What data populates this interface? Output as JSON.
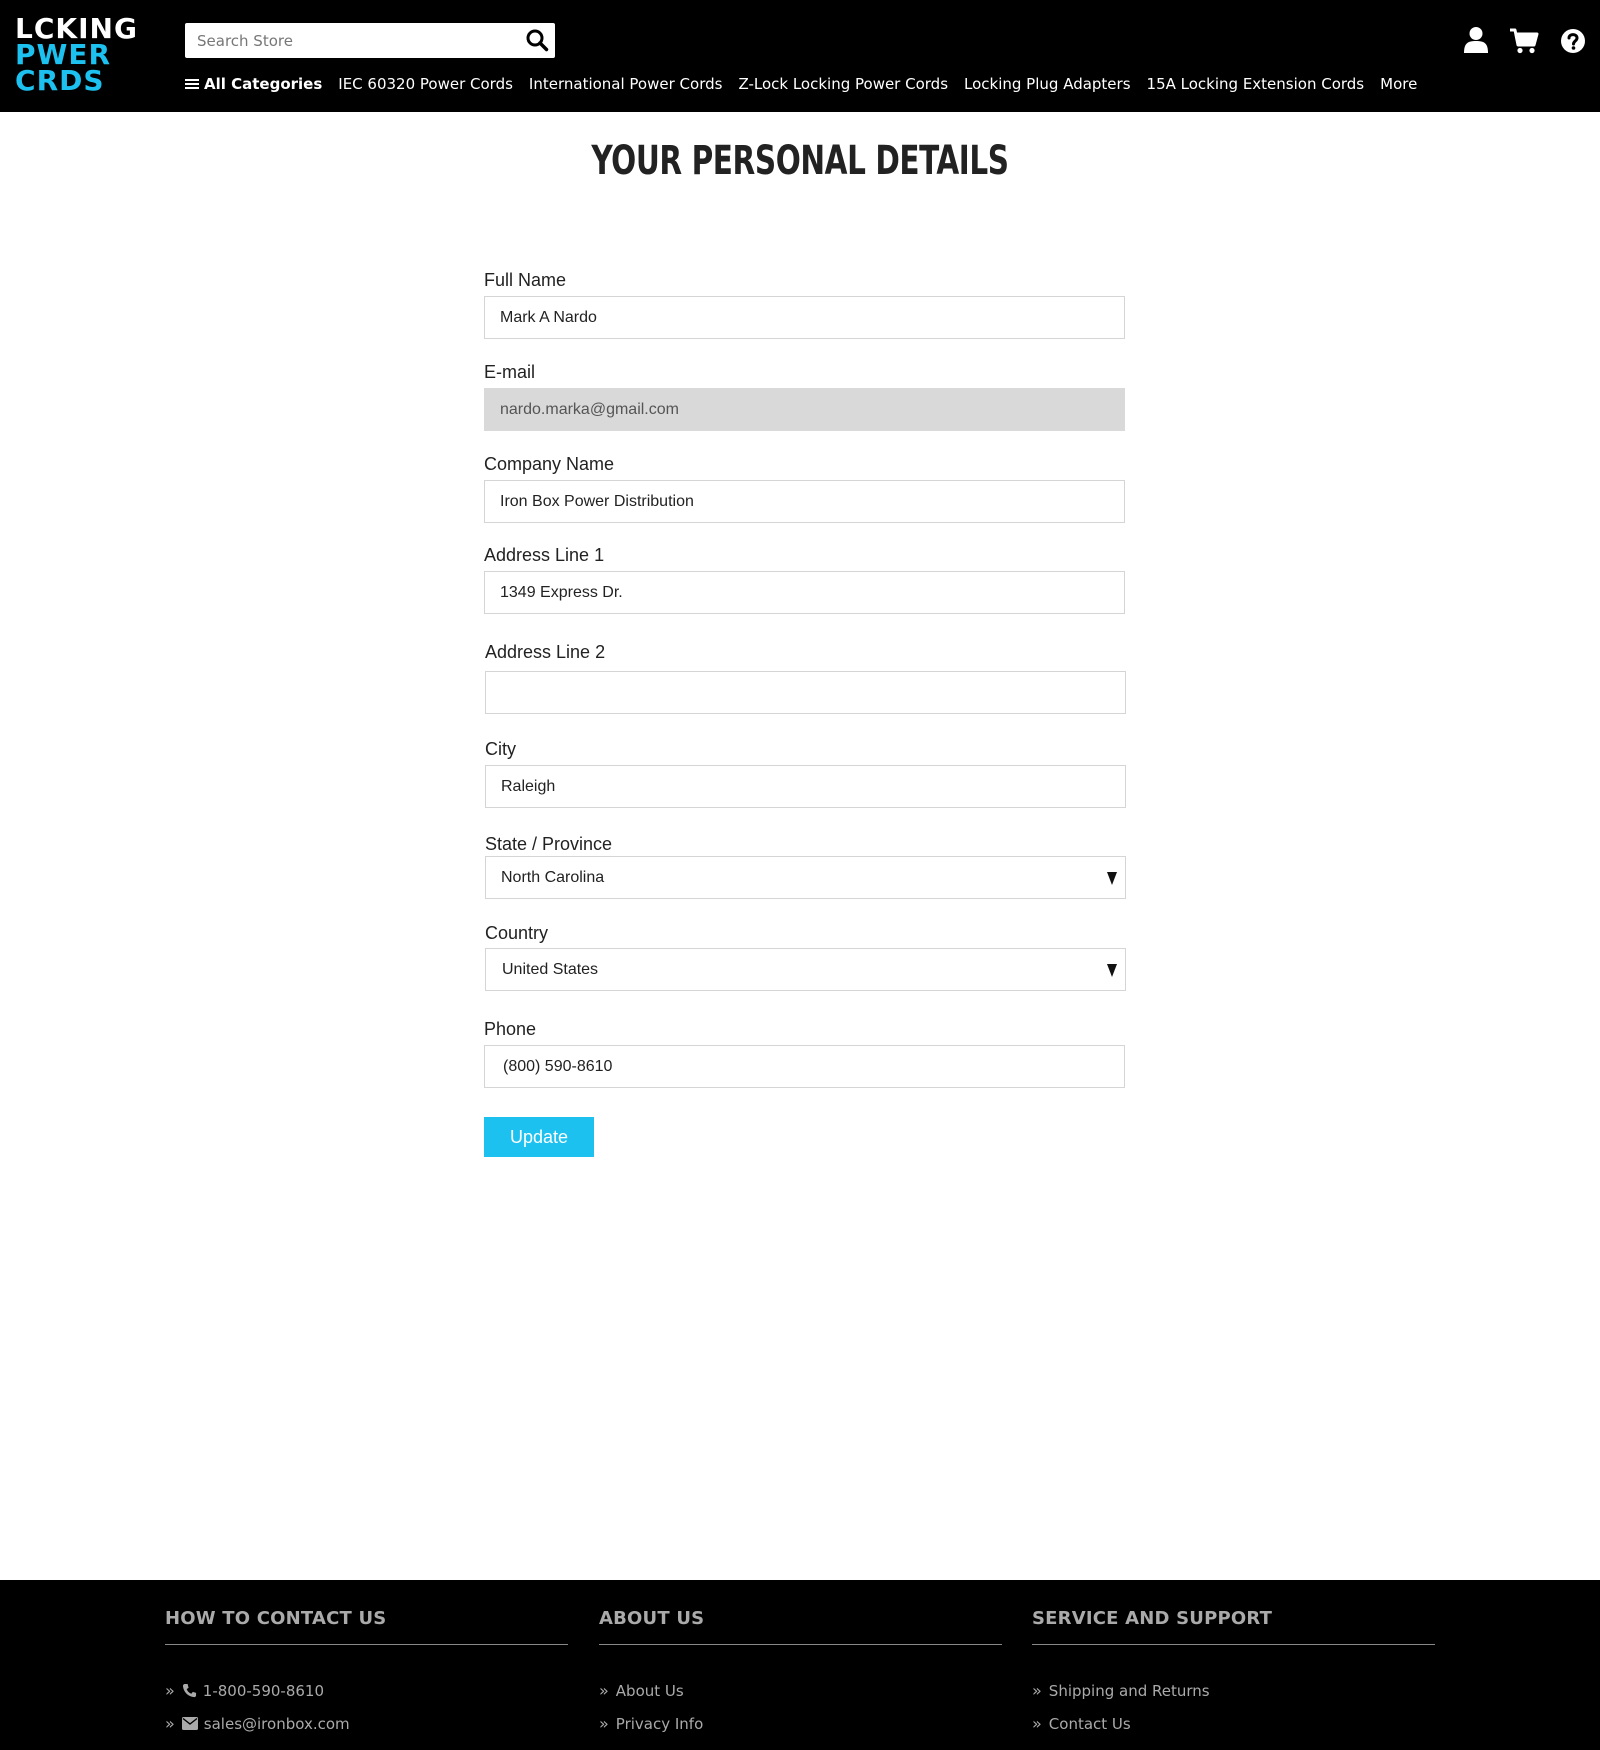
{
  "header": {
    "logo": {
      "line1": [
        "L",
        "CKING"
      ],
      "line2": [
        "P",
        "WER"
      ],
      "line3": [
        "C",
        "RDS"
      ]
    },
    "search_placeholder": "Search Store",
    "nav": [
      "All Categories",
      "IEC 60320 Power Cords",
      "International Power Cords",
      "Z-Lock Locking Power Cords",
      "Locking Plug Adapters",
      "15A Locking Extension Cords",
      "More"
    ],
    "icons": [
      "user-icon",
      "cart-icon",
      "help-icon"
    ],
    "colors": {
      "background": "#000000",
      "accent": "#1dc1f0"
    }
  },
  "page": {
    "title": "YOUR PERSONAL DETAILS"
  },
  "form": {
    "full_name": {
      "label": "Full Name",
      "value": "Mark A Nardo"
    },
    "email": {
      "label": "E-mail",
      "value": "nardo.marka@gmail.com"
    },
    "company": {
      "label": "Company Name",
      "value": "Iron Box Power Distribution"
    },
    "address1": {
      "label": "Address Line 1",
      "value": "1349 Express Dr."
    },
    "address2": {
      "label": "Address Line 2",
      "value": ""
    },
    "city": {
      "label": "City",
      "value": "Raleigh"
    },
    "state": {
      "label": "State / Province",
      "value": "North Carolina"
    },
    "country": {
      "label": "Country",
      "value": "United States"
    },
    "phone": {
      "label": "Phone",
      "value": "(800) 590-8610"
    },
    "submit_label": "Update"
  },
  "footer": {
    "contact": {
      "heading": "HOW TO CONTACT US",
      "phone": "1-800-590-8610",
      "email": "sales@ironbox.com"
    },
    "about": {
      "heading": "ABOUT US",
      "links": [
        "About Us",
        "Privacy Info"
      ]
    },
    "support": {
      "heading": "SERVICE AND SUPPORT",
      "links": [
        "Shipping and Returns",
        "Contact Us"
      ]
    }
  }
}
